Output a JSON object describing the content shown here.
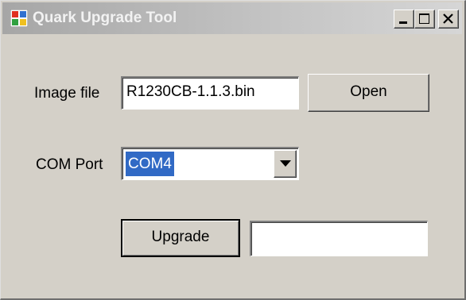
{
  "window": {
    "title": "Quark Upgrade Tool"
  },
  "caption_buttons": {
    "minimize_icon": "minimize-icon",
    "maximize_icon": "maximize-icon",
    "close_icon": "close-icon"
  },
  "image_file": {
    "label": "Image file",
    "value": "R1230CB-1.1.3.bin",
    "open_label": "Open"
  },
  "com_port": {
    "label": "COM Port",
    "selected": "COM4",
    "arrow_icon": "dropdown-arrow-icon"
  },
  "upgrade": {
    "button_label": "Upgrade",
    "status_value": ""
  },
  "colors": {
    "face": "#d4d0c8",
    "selection": "#316ac5",
    "title_gradient_start": "#a6a6a6",
    "title_gradient_end": "#d6d6d6"
  }
}
